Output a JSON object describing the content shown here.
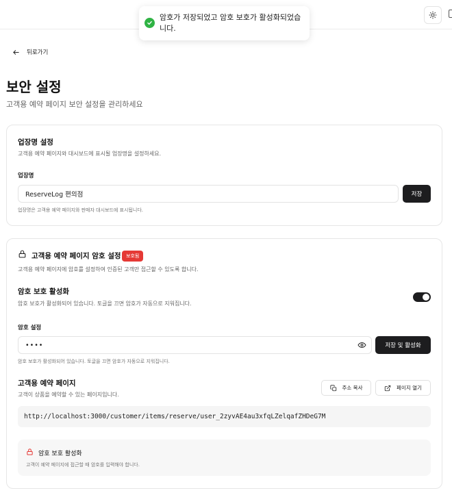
{
  "toast": {
    "message": "암호가 저장되었고 암호 보호가 활성화되었습니다."
  },
  "header": {
    "back_label": "뒤로가기",
    "title": "보안 설정",
    "subtitle": "고객용 예약 페이지 보안 설정을 관리하세요"
  },
  "store_card": {
    "title": "업장명 설정",
    "description": "고객용 예약 페이지와 대시보드에 표시될 업장명을 설정하세요.",
    "field_label": "업장명",
    "field_value": "ReserveLog 편의점",
    "save_label": "저장",
    "help": "업장명은 고객용 예약 페이지와 판매자 대시보드에 표시됩니다."
  },
  "password_card": {
    "title": "고객용 예약 페이지 암호 설정",
    "badge": "보호됨",
    "description": "고객용 예약 페이지에 암호를 설정하여 인증된 고객만 접근할 수 있도록 합니다.",
    "toggle_title": "암호 보호 활성화",
    "toggle_description": "암호 보호가 활성화되어 있습니다. 토글을 끄면 암호가 자동으로 지워집니다.",
    "toggle_on": true,
    "password_label": "암호 설정",
    "password_value": "••••",
    "save_activate_label": "저장 및 활성화",
    "password_help": "암호 보호가 활성화되어 있습니다. 토글을 끄면 암호가 자동으로 지워집니다.",
    "page_title": "고객용 예약 페이지",
    "page_description": "고객이 상품을 예약할 수 있는 페이지입니다.",
    "copy_label": "주소 복사",
    "open_label": "페이지 열기",
    "url": "http://localhost:3000/customer/items/reserve/user_2zyvAE4au3xfqLZelqafZHDeG7M",
    "notice_title": "암호 보호 활성화",
    "notice_description": "고객이 예약 페이지에 접근할 때 암호를 입력해야 합니다."
  },
  "colors": {
    "success": "#2fb344",
    "danger": "#e53935",
    "primary_button": "#1d1d1f"
  },
  "icons": [
    "sun-icon",
    "check-circle-icon",
    "arrow-left-icon",
    "lock-icon",
    "eye-icon",
    "copy-icon",
    "external-link-icon"
  ]
}
